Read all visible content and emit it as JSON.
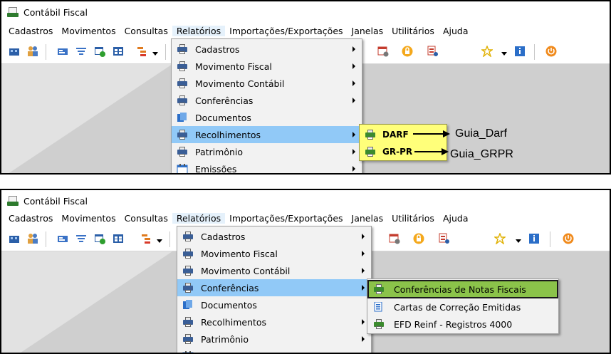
{
  "app": {
    "title": "Contábil Fiscal"
  },
  "menubar": [
    "Cadastros",
    "Movimentos",
    "Consultas",
    "Relatórios",
    "Importações/Exportações",
    "Janelas",
    "Utilitários",
    "Ajuda"
  ],
  "relatorios_menu": [
    {
      "label": "Cadastros",
      "icon": "printer-icon",
      "has_submenu": true
    },
    {
      "label": "Movimento Fiscal",
      "icon": "printer-icon",
      "has_submenu": true
    },
    {
      "label": "Movimento Contábil",
      "icon": "printer-icon",
      "has_submenu": true
    },
    {
      "label": "Conferências",
      "icon": "printer-icon",
      "has_submenu": true
    },
    {
      "label": "Documentos",
      "icon": "documents-icon",
      "has_submenu": false
    },
    {
      "label": "Recolhimentos",
      "icon": "printer-icon",
      "has_submenu": true
    },
    {
      "label": "Patrimônio",
      "icon": "printer-icon",
      "has_submenu": true
    },
    {
      "label": "Emissões",
      "icon": "calendar-icon",
      "has_submenu": true
    }
  ],
  "panel1": {
    "highlighted_item": "Recolhimentos",
    "submenu": [
      "DARF",
      "GR-PR"
    ],
    "annotations": [
      "Guia_Darf",
      "Guia_GRPR"
    ]
  },
  "panel2": {
    "highlighted_item": "Conferências",
    "submenu": [
      "Conferências de Notas Fiscais",
      "Cartas de Correção Emitidas",
      "EFD Reinf - Registros 4000"
    ],
    "selected_submenu_item": "Conferências de Notas Fiscais"
  },
  "colors": {
    "menu_highlight": "#91c9f7",
    "yellow_submenu": "#ffff7a",
    "selected_green": "#8bc34a",
    "printer_blue": "#3a5e96",
    "printer_green": "#3b8a2e"
  }
}
